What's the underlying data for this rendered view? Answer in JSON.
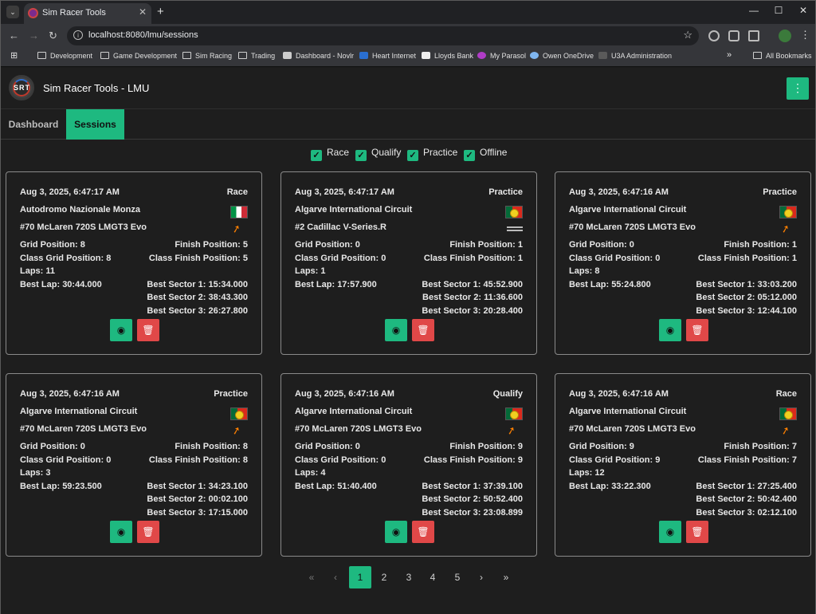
{
  "browser": {
    "tab_title": "Sim Racer Tools",
    "url": "localhost:8080/lmu/sessions",
    "bookmarks": [
      {
        "label": "Development",
        "icon": "folder-icon"
      },
      {
        "label": "Game Development",
        "icon": "folder-icon"
      },
      {
        "label": "Sim Racing",
        "icon": "folder-icon"
      },
      {
        "label": "Trading",
        "icon": "folder-icon"
      },
      {
        "label": "Dashboard - Novlr",
        "icon": "book-icon"
      },
      {
        "label": "Heart Internet",
        "icon": "heart-internet-icon"
      },
      {
        "label": "Lloyds Bank",
        "icon": "lloyds-icon"
      },
      {
        "label": "My Parasol",
        "icon": "parasol-icon"
      },
      {
        "label": "Owen OneDrive",
        "icon": "onedrive-icon"
      },
      {
        "label": "U3A Administration",
        "icon": "u3a-icon"
      }
    ],
    "all_bookmarks": "All Bookmarks",
    "more": "»"
  },
  "app": {
    "logo_text": "SRT",
    "title": "Sim Racer Tools - LMU",
    "tabs": [
      {
        "label": "Dashboard",
        "active": false
      },
      {
        "label": "Sessions",
        "active": true
      }
    ],
    "filters": [
      {
        "label": "Race",
        "checked": true
      },
      {
        "label": "Qualify",
        "checked": true
      },
      {
        "label": "Practice",
        "checked": true
      },
      {
        "label": "Offline",
        "checked": true
      }
    ]
  },
  "labels": {
    "grid": "Grid Position: ",
    "finish": "Finish Position: ",
    "class_grid": "Class Grid Position: ",
    "class_finish": "Class Finish Position: ",
    "laps": "Laps: ",
    "best_lap": "Best Lap: ",
    "s1": "Best Sector 1: ",
    "s2": "Best Sector 2: ",
    "s3": "Best Sector 3: "
  },
  "sessions": [
    {
      "date": "Aug 3, 2025, 6:47:17 AM",
      "type": "Race",
      "track": "Autodromo Nazionale Monza",
      "flag": "italy",
      "car": "#70 McLaren 720S LMGT3 Evo",
      "brand": "mclaren",
      "grid": "8",
      "finish": "5",
      "class_grid": "8",
      "class_finish": "5",
      "laps": "11",
      "best_lap": "30:44.000",
      "s1": "15:34.000",
      "s2": "38:43.300",
      "s3": "26:27.800"
    },
    {
      "date": "Aug 3, 2025, 6:47:17 AM",
      "type": "Practice",
      "track": "Algarve International Circuit",
      "flag": "portugal",
      "car": "#2 Cadillac V-Series.R",
      "brand": "cadillac",
      "grid": "0",
      "finish": "1",
      "class_grid": "0",
      "class_finish": "1",
      "laps": "1",
      "best_lap": "17:57.900",
      "s1": "45:52.900",
      "s2": "11:36.600",
      "s3": "20:28.400"
    },
    {
      "date": "Aug 3, 2025, 6:47:16 AM",
      "type": "Practice",
      "track": "Algarve International Circuit",
      "flag": "portugal",
      "car": "#70 McLaren 720S LMGT3 Evo",
      "brand": "mclaren",
      "grid": "0",
      "finish": "1",
      "class_grid": "0",
      "class_finish": "1",
      "laps": "8",
      "best_lap": "55:24.800",
      "s1": "33:03.200",
      "s2": "05:12.000",
      "s3": "12:44.100"
    },
    {
      "date": "Aug 3, 2025, 6:47:16 AM",
      "type": "Practice",
      "track": "Algarve International Circuit",
      "flag": "portugal",
      "car": "#70 McLaren 720S LMGT3 Evo",
      "brand": "mclaren",
      "grid": "0",
      "finish": "8",
      "class_grid": "0",
      "class_finish": "8",
      "laps": "3",
      "best_lap": "59:23.500",
      "s1": "34:23.100",
      "s2": "00:02.100",
      "s3": "17:15.000"
    },
    {
      "date": "Aug 3, 2025, 6:47:16 AM",
      "type": "Qualify",
      "track": "Algarve International Circuit",
      "flag": "portugal",
      "car": "#70 McLaren 720S LMGT3 Evo",
      "brand": "mclaren",
      "grid": "0",
      "finish": "9",
      "class_grid": "0",
      "class_finish": "9",
      "laps": "4",
      "best_lap": "51:40.400",
      "s1": "37:39.100",
      "s2": "50:52.400",
      "s3": "23:08.899"
    },
    {
      "date": "Aug 3, 2025, 6:47:16 AM",
      "type": "Race",
      "track": "Algarve International Circuit",
      "flag": "portugal",
      "car": "#70 McLaren 720S LMGT3 Evo",
      "brand": "mclaren",
      "grid": "9",
      "finish": "7",
      "class_grid": "9",
      "class_finish": "7",
      "laps": "12",
      "best_lap": "33:22.300",
      "s1": "27:25.400",
      "s2": "50:42.400",
      "s3": "02:12.100"
    }
  ],
  "pagination": {
    "first": "«",
    "prev": "‹",
    "pages": [
      "1",
      "2",
      "3",
      "4",
      "5"
    ],
    "current": "1",
    "next": "›",
    "last": "»"
  }
}
